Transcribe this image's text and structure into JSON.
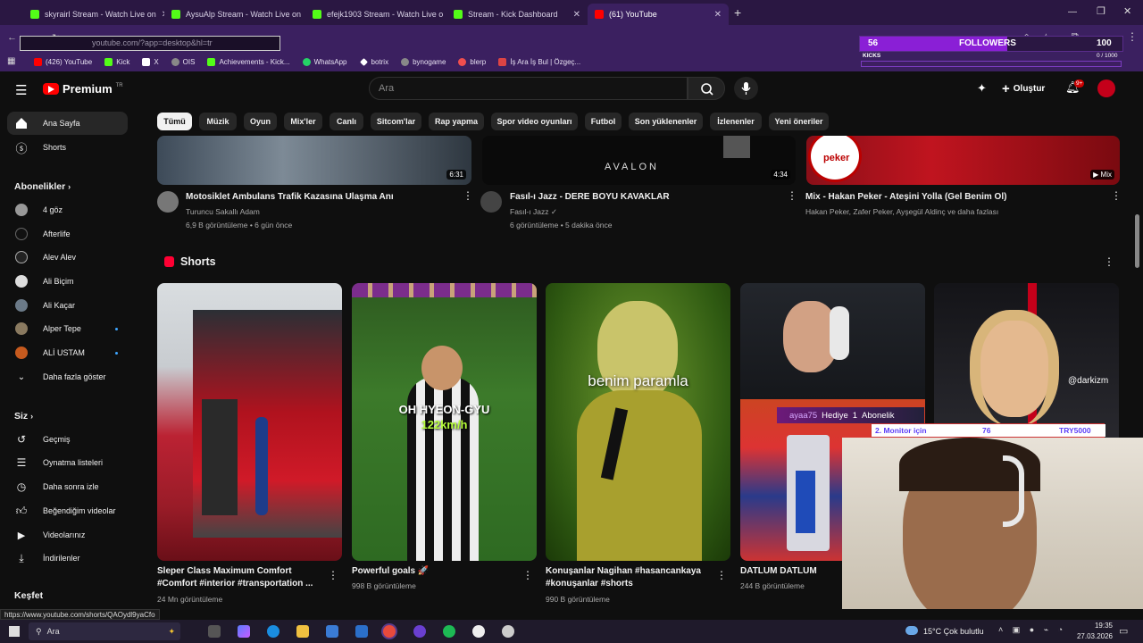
{
  "browser": {
    "tabs": [
      {
        "title": "skyrairl Stream - Watch Live on",
        "active": false,
        "icon_color": "#53fc18"
      },
      {
        "title": "AysuAlp Stream - Watch Live on",
        "active": false,
        "icon_color": "#53fc18"
      },
      {
        "title": "efejk1903 Stream - Watch Live o",
        "active": false,
        "icon_color": "#53fc18"
      },
      {
        "title": "Stream - Kick Dashboard",
        "active": false,
        "icon_color": "#53fc18"
      },
      {
        "title": "(61) YouTube",
        "active": true,
        "icon_color": "#ff0000"
      }
    ],
    "new_tab": "+",
    "url": "youtube.com/?app=desktop&hl=tr",
    "bookmarks": [
      {
        "label": "(426) YouTube",
        "color": "#ff0000"
      },
      {
        "label": "Kick",
        "color": "#53fc18"
      },
      {
        "label": "X",
        "color": "#ffffff"
      },
      {
        "label": "OIS",
        "color": "#888888"
      },
      {
        "label": "Achievements - Kick...",
        "color": "#53fc18"
      },
      {
        "label": "WhatsApp",
        "color": "#25d366"
      },
      {
        "label": "botrix",
        "color": "#ffffff"
      },
      {
        "label": "bynogame",
        "color": "#888888"
      },
      {
        "label": "blerp",
        "color": "#f04e4e"
      },
      {
        "label": "İş Ara İş Bul | Özgeç...",
        "color": "#d44"
      }
    ]
  },
  "overlay": {
    "count": "56",
    "label": "FOLLOWERS",
    "goal": "100",
    "kicks_label": "KICKS",
    "kicks_progress": "0 / 1000",
    "follower_progress_fraction": 0.56,
    "accent": "#8a1fd6"
  },
  "youtube": {
    "logo_text": "Premium",
    "logo_sup": "TR",
    "search_placeholder": "Ara",
    "create_label": "Oluştur",
    "notif_badge": "9+",
    "chips": [
      "Tümü",
      "Müzik",
      "Oyun",
      "Mix'ler",
      "Canlı",
      "Sitcom'lar",
      "Rap yapma",
      "Spor video oyunları",
      "Futbol",
      "Son yüklenenler",
      "İzlenenler",
      "Yeni öneriler"
    ],
    "sidebar": {
      "home": "Ana Sayfa",
      "shorts": "Shorts",
      "subs_header": "Abonelikler",
      "subs": [
        {
          "name": "4 göz",
          "dot": false
        },
        {
          "name": "Afterlife",
          "dot": false
        },
        {
          "name": "Alev Alev",
          "dot": false
        },
        {
          "name": "Ali Biçim",
          "dot": false
        },
        {
          "name": "Ali Kaçar",
          "dot": false
        },
        {
          "name": "Alper Tepe",
          "dot": true
        },
        {
          "name": "ALİ USTAM",
          "dot": true
        }
      ],
      "show_more": "Daha fazla göster",
      "you_header": "Siz",
      "you_items": [
        "Geçmiş",
        "Oynatma listeleri",
        "Daha sonra izle",
        "Beğendiğim videolar",
        "Videolarınız",
        "İndirilenler"
      ],
      "explore_header": "Keşfet"
    },
    "videos": [
      {
        "title": "Motosiklet Ambulans Trafik Kazasına Ulaşma Anı",
        "channel": "Turuncu Sakallı Adam",
        "meta": "6,9 B görüntüleme • 6 gün önce",
        "duration": "6:31"
      },
      {
        "title": "Fasıl-ı Jazz - DERE BOYU KAVAKLAR",
        "channel": "Fasıl-ı Jazz",
        "meta": "6 görüntüleme • 5 dakika önce",
        "duration": "4:34",
        "thumb_text": "AVALON"
      },
      {
        "title": "Mix - Hakan Peker - Ateşini Yolla  (Gel Benim Ol)",
        "channel": "Hakan Peker, Zafer Peker, Ayşegül Aldinç ve daha fazlası",
        "meta": "",
        "duration": "Mix",
        "thumb_text": "peker"
      }
    ],
    "shorts_header": "Shorts",
    "shorts": [
      {
        "title": "Sleper Class Maximum Comfort #Comfort #interior #transportation ...",
        "meta": "24 Mn görüntüleme",
        "overlay": ""
      },
      {
        "title": "Powerful goals 🚀",
        "meta": "998 B görüntüleme",
        "overlay": "OH HYEON-GYU",
        "overlay2": "122km/h"
      },
      {
        "title": "Konuşanlar Nagihan #hasancankaya #konuşanlar #shorts",
        "meta": "990 B görüntüleme",
        "overlay": "benim paramla"
      },
      {
        "title": "DATLUM DATLUM",
        "meta": "244 B görüntüleme",
        "overlay": ""
      },
      {
        "title": "",
        "meta": "",
        "overlay": "@darkizm"
      }
    ]
  },
  "stream_overlay": {
    "gift_user": "ayaa75",
    "gift_word": "Hediye",
    "gift_count": "1",
    "gift_tail": "Abonelik",
    "goal_text": "2. Monitor için",
    "goal_value": "76",
    "goal_target": "TRY5000"
  },
  "status_url": "https://www.youtube.com/shorts/QAOydl9yaCfo",
  "taskbar": {
    "search": "Ara",
    "weather": "15°C  Çok bulutlu",
    "time": "19:35",
    "date": "27.03.2026"
  }
}
